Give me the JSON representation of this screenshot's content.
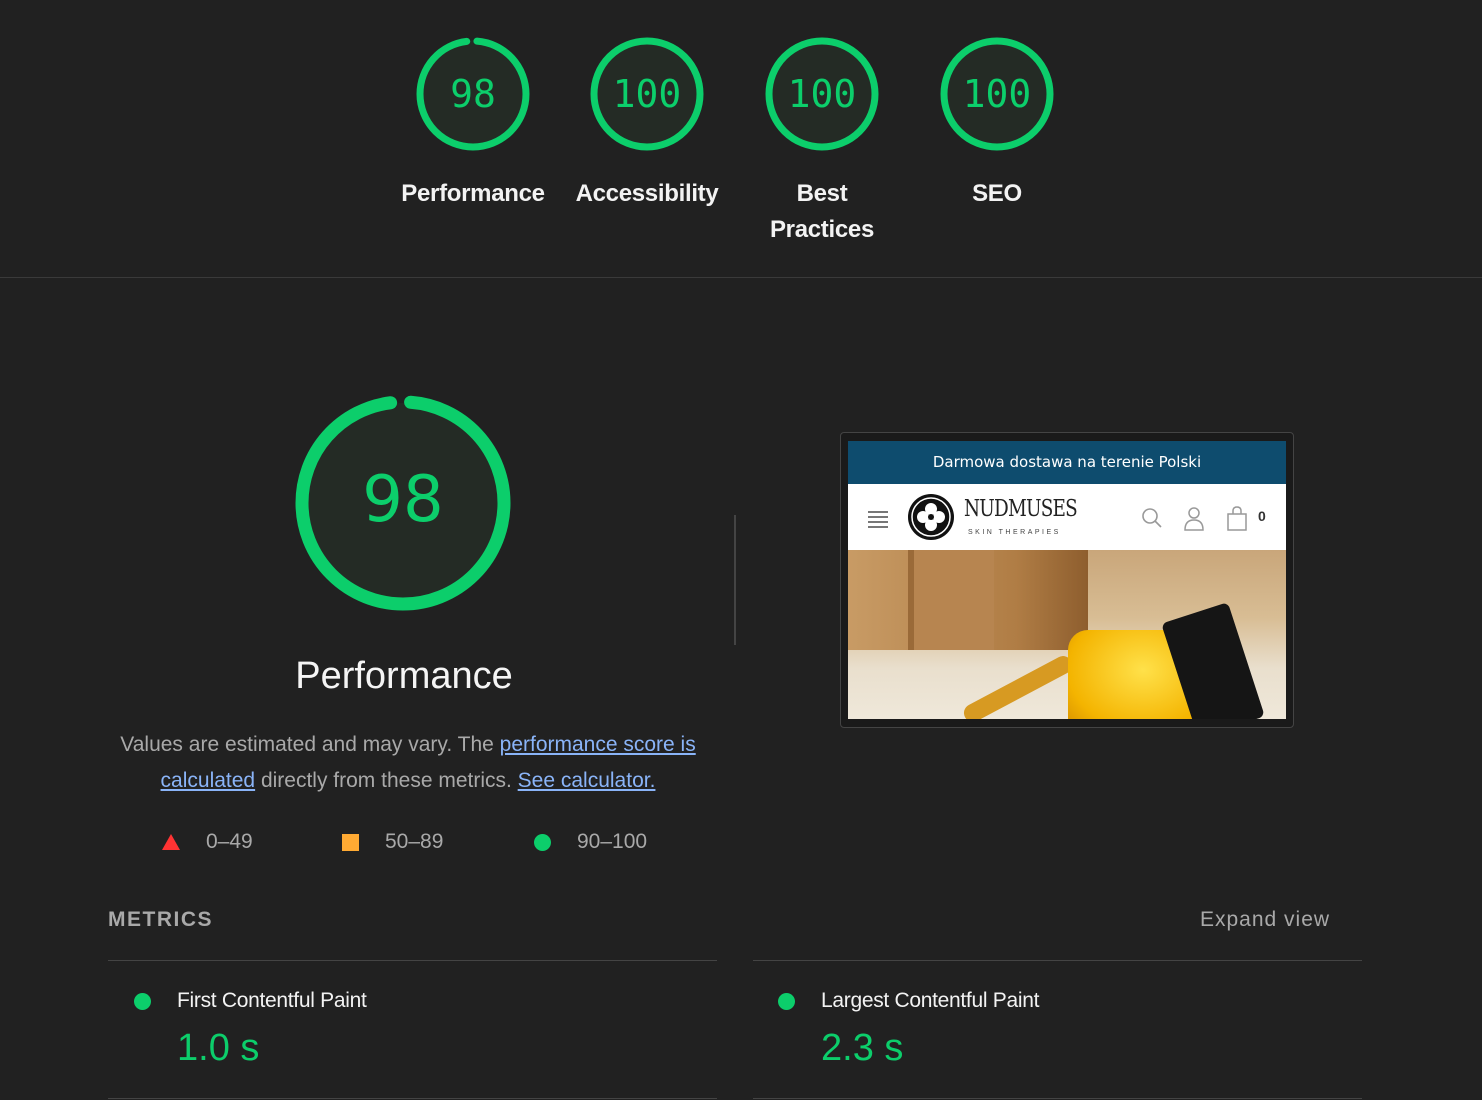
{
  "colors": {
    "pass": "#0cce6b",
    "average": "#ffaa33",
    "fail": "#ff3333",
    "link": "#8ab4f8",
    "background": "#212121"
  },
  "categories": [
    {
      "label": "Performance",
      "score": 98
    },
    {
      "label": "Accessibility",
      "score": 100
    },
    {
      "label": "Best Practices",
      "score": 100
    },
    {
      "label": "SEO",
      "score": 100
    }
  ],
  "performance": {
    "score": 98,
    "title": "Performance",
    "description_prefix": "Values are estimated and may vary. The ",
    "link_score": "performance score is calculated",
    "description_middle": " directly from these metrics. ",
    "link_calculator": "See calculator."
  },
  "legend": [
    {
      "icon": "triangle-icon",
      "range": "0–49"
    },
    {
      "icon": "square-icon",
      "range": "50–89"
    },
    {
      "icon": "circle-icon",
      "range": "90–100"
    }
  ],
  "screenshot": {
    "promo_text": "Darmowa dostawa na terenie Polski",
    "brand": "NUDMUSES",
    "tagline": "SKIN THERAPIES",
    "cart_count": "0"
  },
  "metrics": {
    "heading": "METRICS",
    "expand_label": "Expand view",
    "items": [
      {
        "label": "First Contentful Paint",
        "value": "1.0 s"
      },
      {
        "label": "Largest Contentful Paint",
        "value": "2.3 s"
      }
    ]
  }
}
